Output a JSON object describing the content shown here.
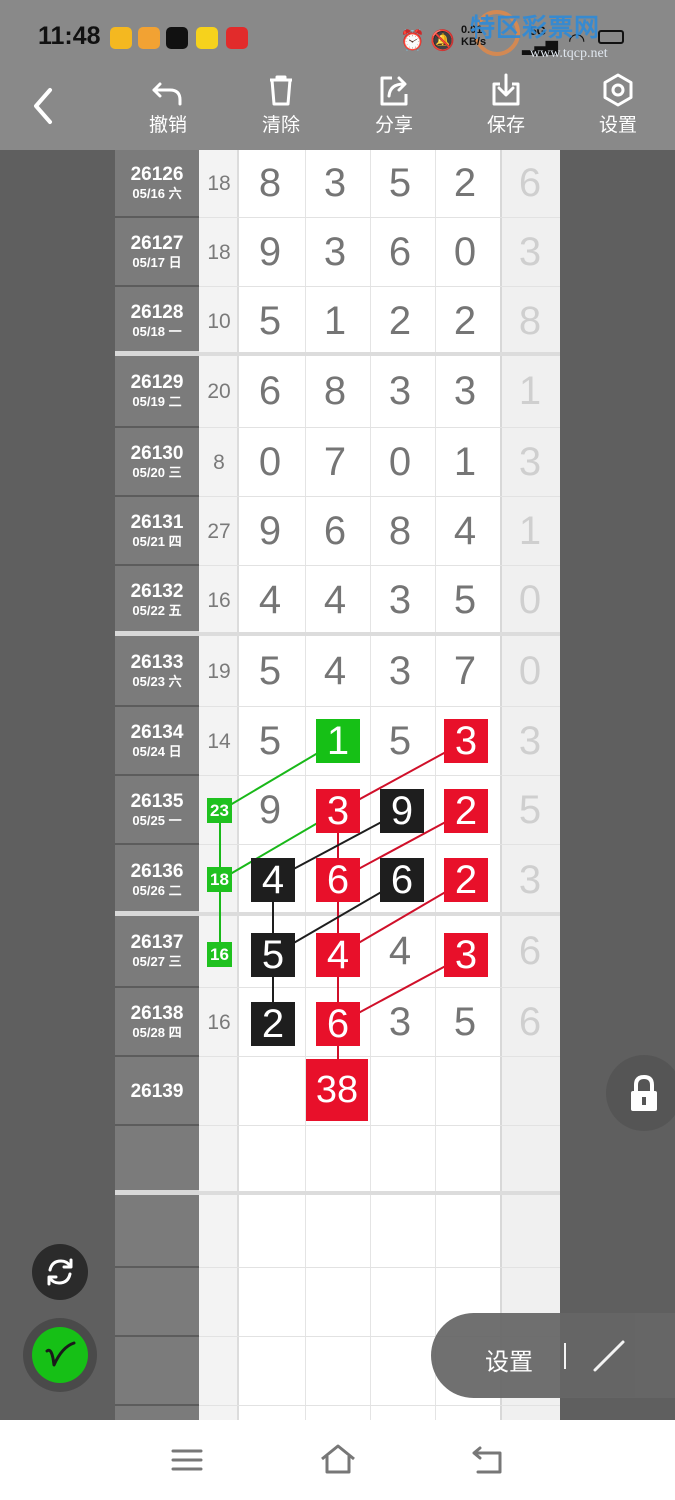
{
  "status_bar": {
    "time": "11:48",
    "net_speed_value": "0.01",
    "net_speed_unit": "KB/s",
    "network_label": "5G",
    "watermark_title": "特区彩票网",
    "watermark_url": "www.tqcp.net",
    "app_icons": [
      "notification-app-icon",
      "video-app-icon",
      "tiktok-icon",
      "meituan-icon",
      "red-app-icon"
    ]
  },
  "toolbar": {
    "undo": "撤销",
    "clear": "清除",
    "share": "分享",
    "save": "保存",
    "settings": "设置"
  },
  "rows": [
    {
      "id": "26126",
      "date": "05/16 六",
      "sum": "18",
      "digits": [
        "8",
        "3",
        "5",
        "2"
      ],
      "last": "6"
    },
    {
      "id": "26127",
      "date": "05/17 日",
      "sum": "18",
      "digits": [
        "9",
        "3",
        "6",
        "0"
      ],
      "last": "3"
    },
    {
      "id": "26128",
      "date": "05/18 一",
      "sum": "10",
      "digits": [
        "5",
        "1",
        "2",
        "2"
      ],
      "last": "8"
    },
    {
      "id": "26129",
      "date": "05/19 二",
      "sum": "20",
      "digits": [
        "6",
        "8",
        "3",
        "3"
      ],
      "last": "1"
    },
    {
      "id": "26130",
      "date": "05/20 三",
      "sum": "8",
      "digits": [
        "0",
        "7",
        "0",
        "1"
      ],
      "last": "3"
    },
    {
      "id": "26131",
      "date": "05/21 四",
      "sum": "27",
      "digits": [
        "9",
        "6",
        "8",
        "4"
      ],
      "last": "1"
    },
    {
      "id": "26132",
      "date": "05/22 五",
      "sum": "16",
      "digits": [
        "4",
        "4",
        "3",
        "5"
      ],
      "last": "0"
    },
    {
      "id": "26133",
      "date": "05/23 六",
      "sum": "19",
      "digits": [
        "5",
        "4",
        "3",
        "7"
      ],
      "last": "0"
    },
    {
      "id": "26134",
      "date": "05/24 日",
      "sum": "14",
      "digits": [
        "5",
        "1",
        "5",
        "3"
      ],
      "last": "3"
    },
    {
      "id": "26135",
      "date": "05/25 一",
      "sum": "23",
      "digits": [
        "9",
        "3",
        "9",
        "2"
      ],
      "last": "5"
    },
    {
      "id": "26136",
      "date": "05/26 二",
      "sum": "18",
      "digits": [
        "4",
        "6",
        "6",
        "2"
      ],
      "last": "3"
    },
    {
      "id": "26137",
      "date": "05/27 三",
      "sum": "16",
      "digits": [
        "5",
        "4",
        "4",
        "3"
      ],
      "last": "6"
    },
    {
      "id": "26138",
      "date": "05/28 四",
      "sum": "16",
      "digits": [
        "2",
        "6",
        "3",
        "5"
      ],
      "last": "6"
    },
    {
      "id": "26139",
      "date": "",
      "sum": "",
      "digits": [
        "",
        "",
        "",
        ""
      ],
      "last": ""
    },
    {
      "id": "",
      "date": "",
      "sum": "",
      "digits": [
        "",
        "",
        "",
        ""
      ],
      "last": ""
    },
    {
      "id": "",
      "date": "",
      "sum": "",
      "digits": [
        "",
        "",
        "",
        ""
      ],
      "last": ""
    },
    {
      "id": "",
      "date": "",
      "sum": "",
      "digits": [
        "",
        "",
        "",
        ""
      ],
      "last": ""
    },
    {
      "id": "",
      "date": "",
      "sum": "",
      "digits": [
        "",
        "",
        "",
        ""
      ],
      "last": ""
    }
  ],
  "marks": {
    "prediction": "38"
  },
  "bottom": {
    "settings_pill_label": "设置"
  },
  "colors": {
    "red_mark": "#e8102a",
    "black_mark": "#1e1e1e",
    "green_mark": "#16c016",
    "toolbar_bg": "#898989"
  }
}
